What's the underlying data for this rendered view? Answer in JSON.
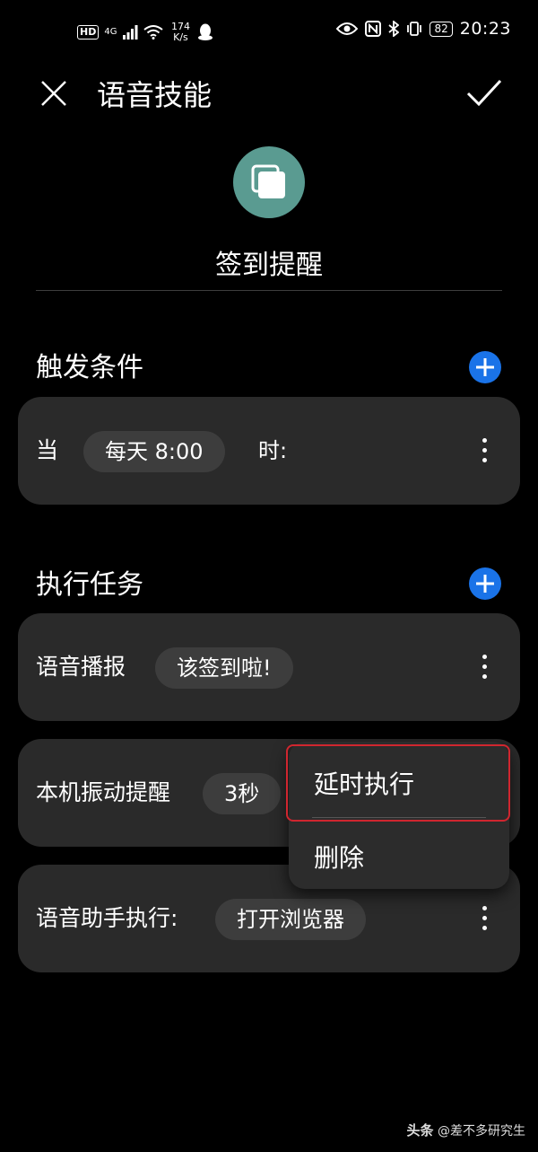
{
  "status_bar": {
    "hd": "HD",
    "network": "4G",
    "speed": "174\nK/s",
    "battery": "82",
    "time": "20:23",
    "icons": [
      "signal-icon",
      "wifi-icon",
      "qq-icon",
      "eye-icon",
      "nfc-icon",
      "bluetooth-icon",
      "vibrate-icon"
    ]
  },
  "header": {
    "title": "语音技能",
    "close_icon": "close-icon",
    "confirm_icon": "check-icon"
  },
  "skill": {
    "name": "签到提醒",
    "icon": "copy-icon",
    "icon_color": "#5a9b91"
  },
  "trigger": {
    "section_label": "触发条件",
    "prefix": "当",
    "time_value": "每天 8:00",
    "suffix": "时:"
  },
  "tasks": {
    "section_label": "执行任务",
    "items": [
      {
        "label": "语音播报",
        "value": "该签到啦!"
      },
      {
        "label": "本机振动提醒",
        "value": "3秒"
      },
      {
        "label": "语音助手执行:",
        "value": "打开浏览器"
      }
    ]
  },
  "popup_menu": {
    "items": [
      "延时执行",
      "删除"
    ],
    "highlight_color": "#d0262f"
  },
  "watermark": {
    "brand": "头条",
    "account": "@差不多研究生"
  },
  "colors": {
    "accent": "#1a73e8",
    "card_bg": "#2a2a2a",
    "pill_bg": "#3d3d3d"
  }
}
